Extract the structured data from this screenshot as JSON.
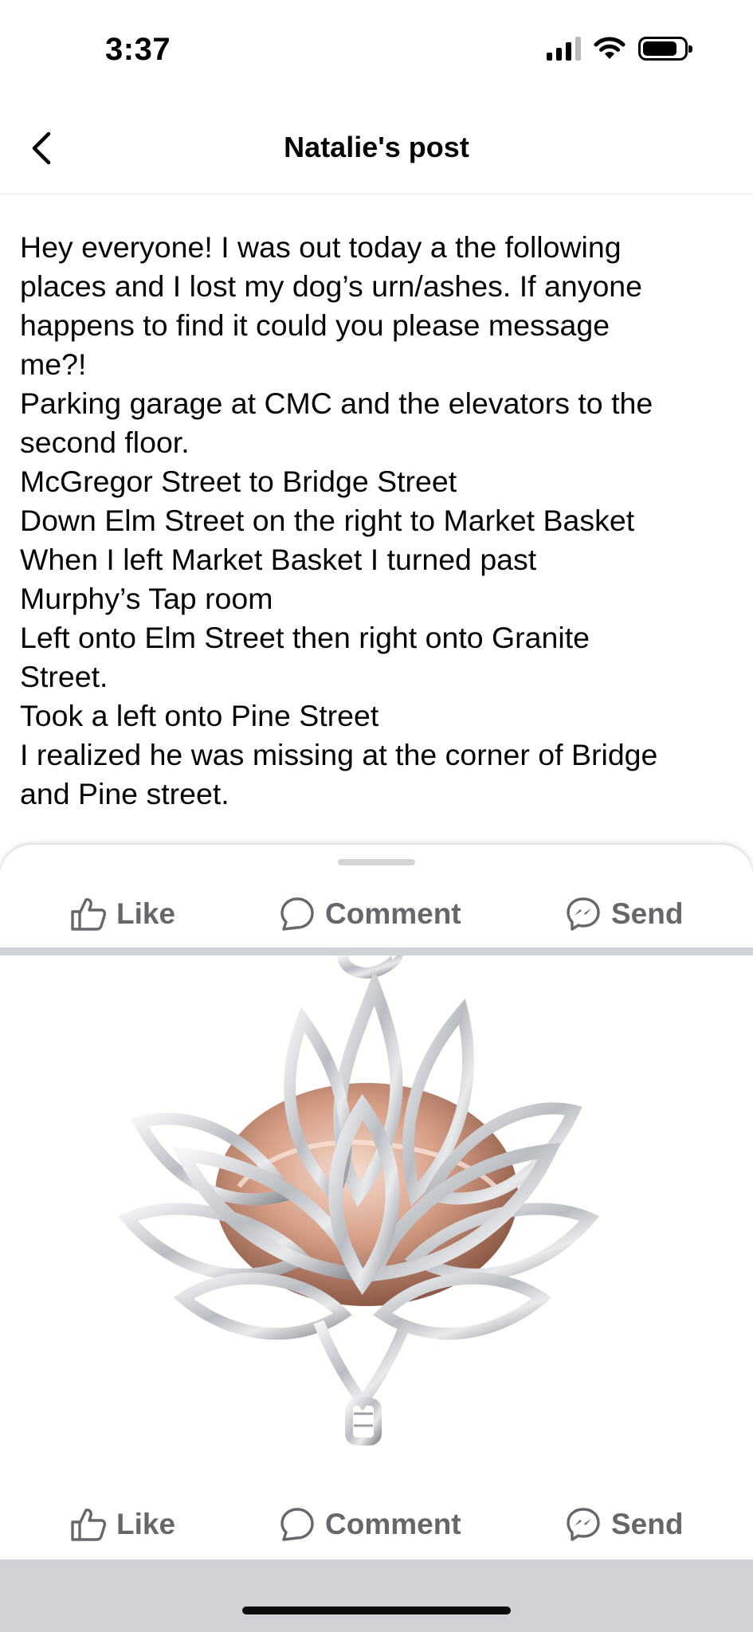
{
  "status_bar": {
    "time": "3:37"
  },
  "header": {
    "title": "Natalie's post"
  },
  "post": {
    "lines": [
      "Hey everyone! I was out today a the following",
      "places and I lost my dog’s urn/ashes. If anyone",
      "happens to find it could you please message",
      "me?!",
      "Parking garage at CMC and the elevators to the",
      "second floor.",
      "McGregor Street to Bridge Street",
      "Down Elm Street on the right to Market Basket",
      "When I left Market Basket I turned past",
      "Murphy’s Tap room",
      "Left onto Elm Street then right onto Granite",
      "Street.",
      "Took a left onto Pine Street",
      "I realized he was missing at the corner of Bridge",
      "and Pine street."
    ]
  },
  "actions": {
    "like_label": "Like",
    "comment_label": "Comment",
    "send_label": "Send"
  },
  "photo": {
    "subject": "lotus-flower-urn-pendant",
    "colors": {
      "metal": "#c9cbcf",
      "rose_gold": "#d9a48e"
    }
  },
  "colors": {
    "action_gray": "#65676b",
    "divider": "#cfd2d6",
    "bottom_bar": "#d0d1d5"
  }
}
